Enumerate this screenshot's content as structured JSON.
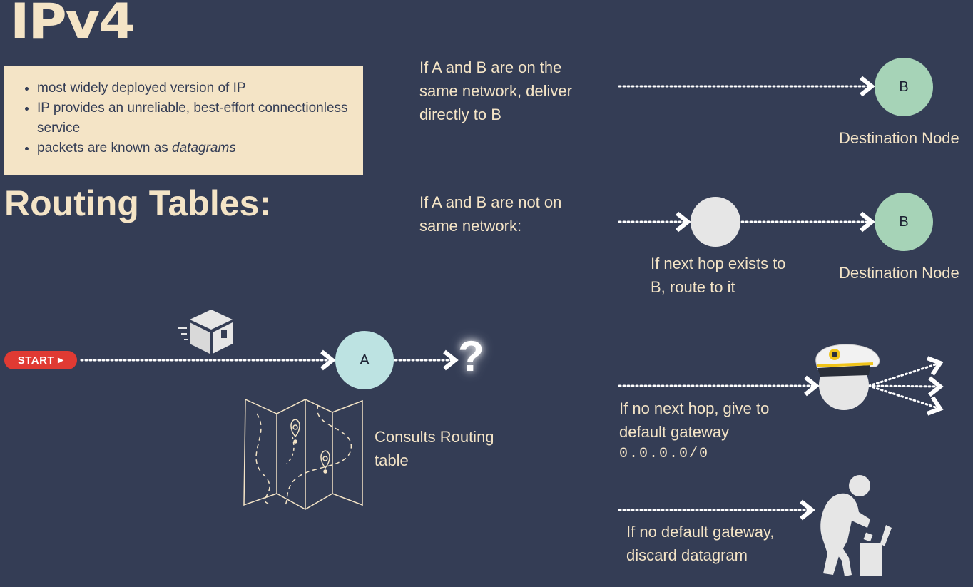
{
  "title": "IPv4",
  "info": {
    "bullets": [
      "most widely deployed version of IP",
      "IP provides an unreliable, best-effort connectionless service"
    ],
    "bullet3_prefix": "packets are known as ",
    "bullet3_em": "datagrams"
  },
  "routing_title": "Routing Tables:",
  "start_label": "START",
  "node_a": "A",
  "question": "?",
  "consults": "Consults Routing table",
  "case_same": "If A and B are on the same network, deliver directly to B",
  "case_not_same": "If A and B are not on same network:",
  "node_b": "B",
  "dest_label": "Destination Node",
  "next_hop": "If next hop exists to B, route to it",
  "no_next_hop": "If no next hop, give to default gateway",
  "default_route": "0.0.0.0/0",
  "no_gateway": "If no default gateway, discard datagram",
  "colors": {
    "background": "#343d55",
    "cream": "#f4e4c6",
    "green_node": "#a6d3b7",
    "cyan_node": "#bde3e2",
    "start_red": "#e03a33"
  },
  "icons": [
    "package-icon",
    "map-icon",
    "captain-hat-icon",
    "person-discarding-icon",
    "arrow-icon"
  ]
}
